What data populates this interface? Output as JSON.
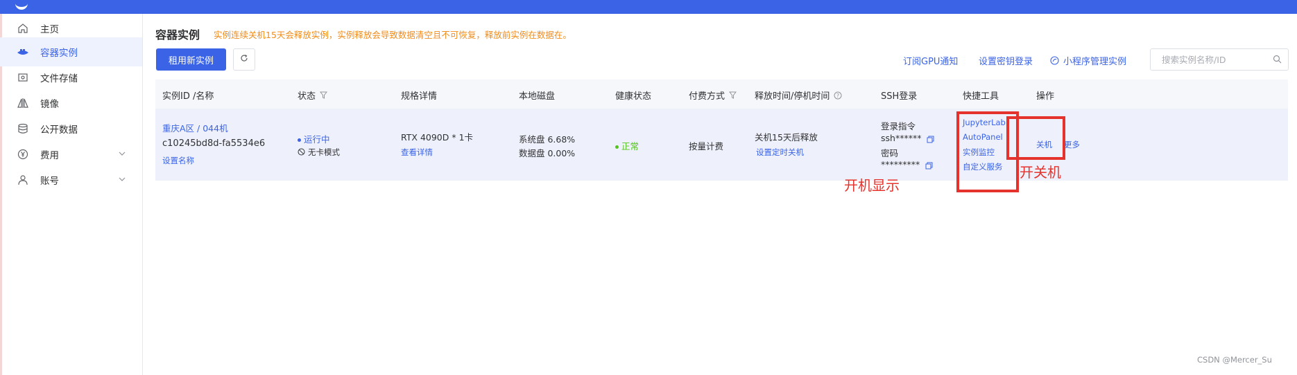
{
  "sidebar": {
    "items": [
      {
        "label": "主页",
        "icon": "home-icon"
      },
      {
        "label": "容器实例",
        "icon": "container-icon"
      },
      {
        "label": "文件存储",
        "icon": "storage-icon"
      },
      {
        "label": "镜像",
        "icon": "image-layers-icon"
      },
      {
        "label": "公开数据",
        "icon": "database-icon"
      },
      {
        "label": "费用",
        "icon": "yen-icon"
      },
      {
        "label": "账号",
        "icon": "user-icon"
      }
    ]
  },
  "header": {
    "title": "容器实例",
    "notice": "实例连续关机15天会释放实例，实例释放会导致数据清空且不可恢复，释放前实例在数据在。"
  },
  "toolbar": {
    "rent_label": "租用新实例",
    "gpu_notify": "订阅GPU通知",
    "key_login": "设置密钥登录",
    "mini_program": "小程序管理实例",
    "search_placeholder": "搜索实例名称/ID"
  },
  "table": {
    "headers": [
      "实例ID /名称",
      "状态",
      "规格详情",
      "本地磁盘",
      "健康状态",
      "付费方式",
      "释放时间/停机时间",
      "SSH登录",
      "快捷工具",
      "操作"
    ],
    "row": {
      "name": "重庆A区 / 044机",
      "id": "c10245bd8d-fa5534e6",
      "set_name": "设置名称",
      "status": "运行中",
      "mode": "无卡模式",
      "spec": "RTX 4090D * 1卡",
      "spec_detail": "查看详情",
      "disk_system": "系统盘 6.68%",
      "disk_data": "数据盘 0.00%",
      "health": "正常",
      "billing": "按量计费",
      "release": "关机15天后释放",
      "set_shutdown": "设置定时关机",
      "ssh_label": "登录指令",
      "ssh_value": "ssh******",
      "pwd_label": "密码",
      "pwd_value": "*********",
      "tools": [
        "JupyterLab",
        "AutoPanel",
        "实例监控",
        "自定义服务"
      ],
      "actions": [
        "关机",
        "更多"
      ]
    }
  },
  "annotations": {
    "tools_note": "开机显示",
    "actions_note": "开关机"
  },
  "watermark": "CSDN @Mercer_Su",
  "colors": {
    "primary": "#3b63e6",
    "notice": "#f08c1a",
    "success": "#52c41a",
    "annotation": "#e5322d"
  }
}
